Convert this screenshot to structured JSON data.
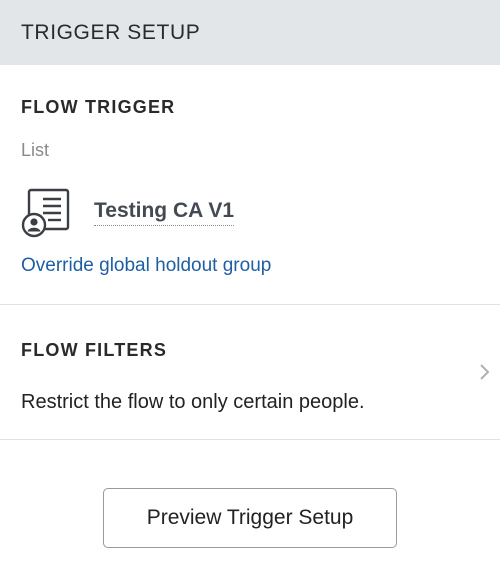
{
  "header": {
    "title": "TRIGGER SETUP"
  },
  "flow_trigger": {
    "heading": "FLOW TRIGGER",
    "type_label": "List",
    "list_name": "Testing CA V1",
    "list_icon": "list-user-icon",
    "override_link": "Override global holdout group"
  },
  "flow_filters": {
    "heading": "FLOW FILTERS",
    "description": "Restrict the flow to only certain people.",
    "chevron_icon": "chevron-right-icon"
  },
  "footer": {
    "preview_button_label": "Preview Trigger Setup"
  },
  "colors": {
    "header_bg": "#e3e6e9",
    "link": "#1e5fa3",
    "muted_text": "#8a8a8a",
    "divider": "#e2e2e2"
  }
}
